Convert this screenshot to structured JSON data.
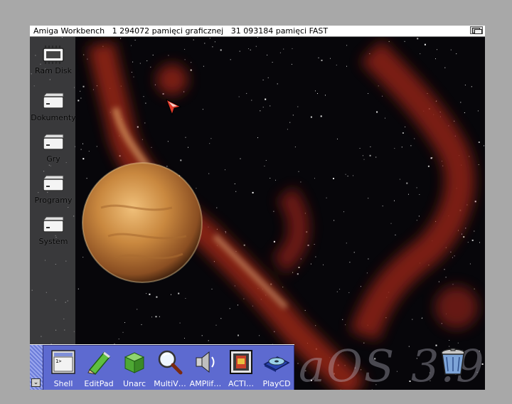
{
  "screen": {
    "title_text": "Amiga Workbench   1 294072 pamięci graficznej   31 093184 pamięci FAST"
  },
  "desktop_icons": [
    {
      "label": "Ram Disk",
      "icon": "ram-disk-icon"
    },
    {
      "label": "Dokumenty",
      "icon": "hard-drive-icon"
    },
    {
      "label": "Gry",
      "icon": "hard-drive-icon"
    },
    {
      "label": "Programy",
      "icon": "hard-drive-icon"
    },
    {
      "label": "System",
      "icon": "hard-drive-icon"
    }
  ],
  "dock": {
    "items": [
      {
        "label": "Shell",
        "icon": "shell-icon"
      },
      {
        "label": "EditPad",
        "icon": "editpad-icon"
      },
      {
        "label": "Unarc",
        "icon": "unarc-box-icon"
      },
      {
        "label": "MultiV…",
        "icon": "magnifier-icon"
      },
      {
        "label": "AMPlif…",
        "icon": "speaker-icon"
      },
      {
        "label": "ACTI…",
        "icon": "acti-icon"
      },
      {
        "label": "PlayCD",
        "icon": "cd-icon"
      }
    ],
    "arrow_label": "⌄"
  },
  "watermark": "aOS 3.9",
  "trashcan": {
    "icon": "trashcan-icon"
  },
  "colors": {
    "title_bar": "#ffffff",
    "dock_bar": "#5d6ad0",
    "space": "#07060a",
    "nebula": "#a3241a",
    "planet": "#c98a43"
  }
}
